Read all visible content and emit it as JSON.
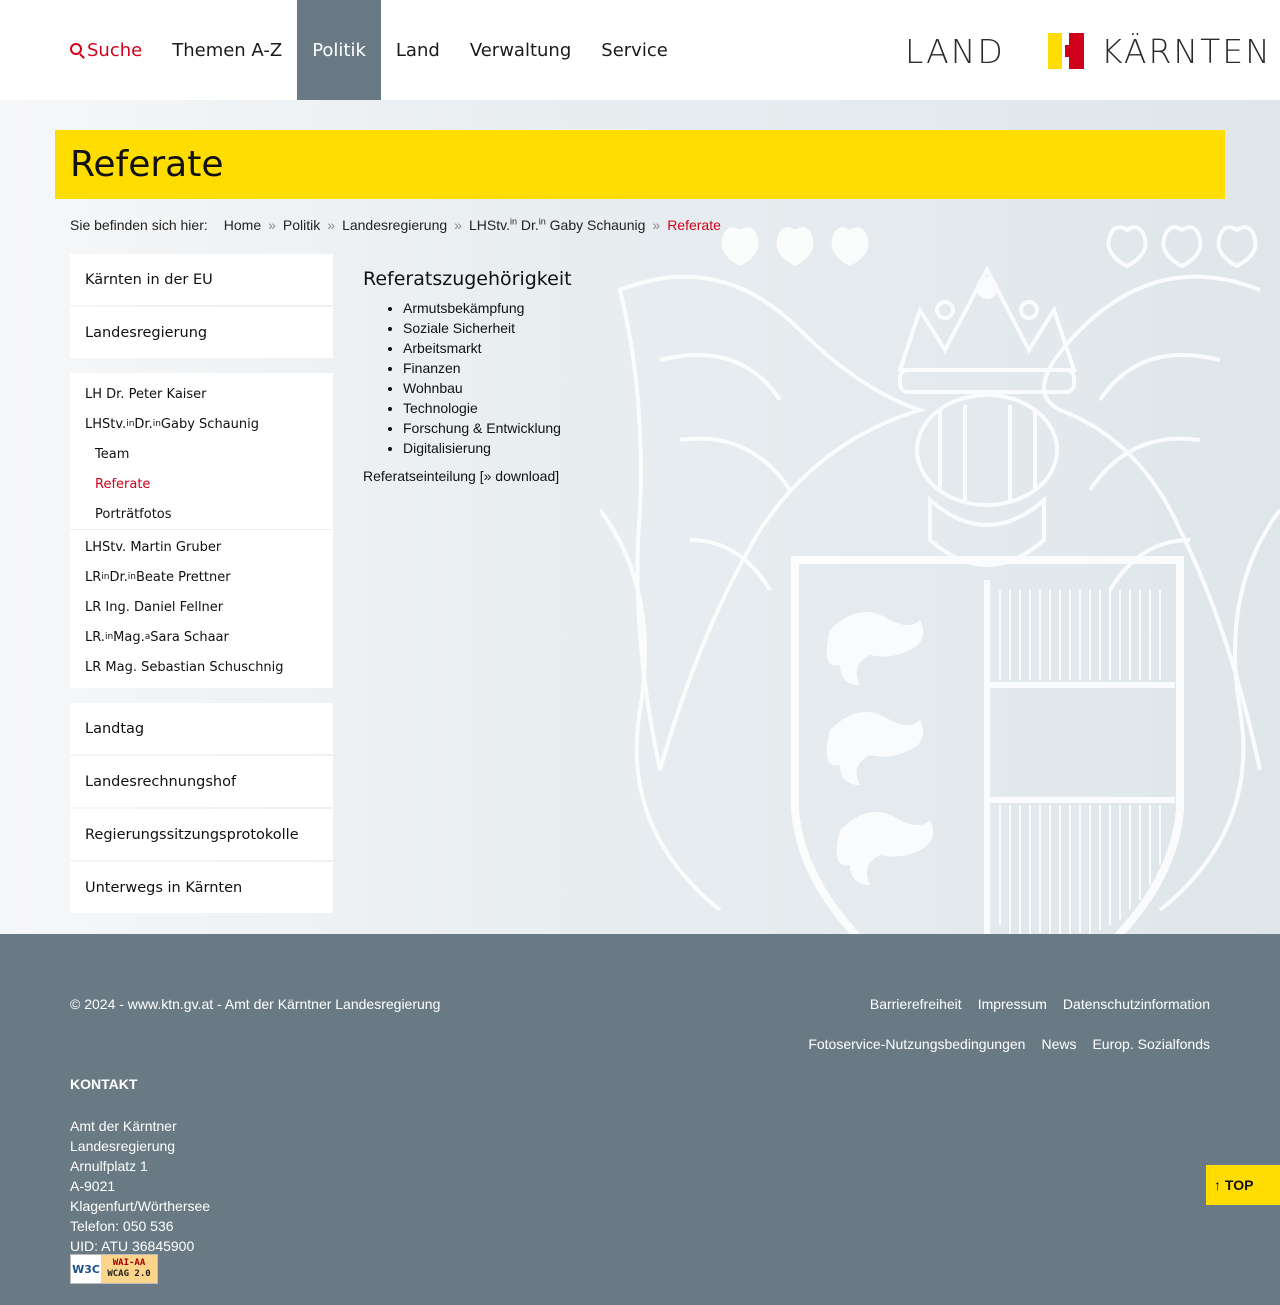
{
  "nav": {
    "search_label": "Suche",
    "items": [
      "Themen A-Z",
      "Politik",
      "Land",
      "Verwaltung",
      "Service"
    ],
    "active": "Politik"
  },
  "logo": {
    "left": "LAND",
    "right": "KÄRNTEN"
  },
  "page": {
    "title": "Referate"
  },
  "breadcrumb": {
    "lead": "Sie befinden sich hier:",
    "items": [
      "Home",
      "Politik",
      "Landesregierung"
    ],
    "person_prefix": "LHStv.",
    "person_sup1": "in",
    "person_mid": " Dr.",
    "person_sup2": "in",
    "person_name": " Gaby Schaunig",
    "current": "Referate"
  },
  "sidebar": {
    "top_items": [
      "Kärnten in der EU",
      "Landesregierung"
    ],
    "sub_items": {
      "kaiser": "LH Dr. Peter Kaiser",
      "schaunig_a": "LHStv.",
      "schaunig_sup1": "in",
      "schaunig_b": " Dr.",
      "schaunig_sup2": "in",
      "schaunig_c": " Gaby Schaunig",
      "team": "Team",
      "referate": "Referate",
      "portraet": "Porträtfotos",
      "gruber": "LHStv. Martin Gruber",
      "prettner_a": "LR",
      "prettner_sup1": "in",
      "prettner_b": " Dr.",
      "prettner_sup2": "in",
      "prettner_c": " Beate Prettner",
      "fellner": "LR Ing. Daniel Fellner",
      "schaar_a": "LR.",
      "schaar_sup1": "in",
      "schaar_b": " Mag.",
      "schaar_sup2": "a",
      "schaar_c": " Sara Schaar",
      "schuschnig": "LR Mag. Sebastian Schuschnig"
    },
    "bottom_items": [
      "Landtag",
      "Landesrechnungshof",
      "Regierungssitzungsprotokolle",
      "Unterwegs in Kärnten"
    ]
  },
  "content": {
    "heading": "Referatszugehörigkeit",
    "list": [
      "Armutsbekämpfung",
      "Soziale Sicherheit",
      "Arbeitsmarkt",
      "Finanzen",
      "Wohnbau",
      "Technologie",
      "Forschung & Entwicklung",
      "Digitalisierung"
    ],
    "download_text": "Referatseinteilung [» download]"
  },
  "footer": {
    "copyright": "© 2024 - www.ktn.gv.at - Amt der Kärntner Landesregierung",
    "links_row1": [
      "Barrierefreiheit",
      "Impressum",
      "Datenschutzinformation"
    ],
    "links_row2": [
      "Fotoservice-Nutzungsbedingungen",
      "News",
      "Europ. Sozialfonds"
    ],
    "kontakt_heading": "KONTAKT",
    "address": [
      "Amt der Kärntner",
      "Landesregierung",
      "Arnulfplatz 1",
      "A-9021",
      "Klagenfurt/Wörthersee",
      "Telefon: 050 536",
      "UID: ATU 36845900"
    ],
    "badge": {
      "left": "W3C",
      "line1": "WAI-AA",
      "line2": "WCAG 2.0"
    }
  },
  "top_button": "↑ TOP",
  "colors": {
    "accent_yellow": "#ffdd00",
    "accent_red": "#d0021b",
    "footer_bg": "#6a7a84"
  }
}
